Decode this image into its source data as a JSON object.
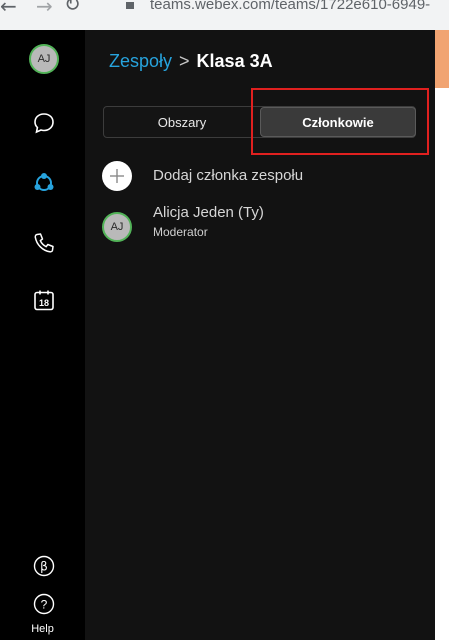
{
  "browser": {
    "url": "teams.webex.com/teams/1722e610-6949-"
  },
  "rail": {
    "avatar_initials": "AJ",
    "icons": [
      "chat-icon",
      "teams-icon",
      "phone-icon",
      "calendar-icon",
      "beta-icon",
      "help-icon"
    ],
    "calendar_day": "18",
    "help_label": "Help",
    "active_color": "#27a3dd"
  },
  "header": {
    "breadcrumb_parent": "Zespoły",
    "breadcrumb_separator": ">",
    "breadcrumb_current": "Klasa 3A"
  },
  "tabs": {
    "areas_label": "Obszary",
    "members_label": "Członkowie",
    "selected": "Członkowie"
  },
  "members": {
    "add_label": "Dodaj członka zespołu",
    "list": [
      {
        "initials": "AJ",
        "name": "Alicja Jeden (Ty)",
        "role": "Moderator"
      }
    ]
  },
  "colors": {
    "accent": "#27a3dd",
    "presence": "#52b358",
    "highlight": "#e0201f",
    "background": "#121212"
  }
}
